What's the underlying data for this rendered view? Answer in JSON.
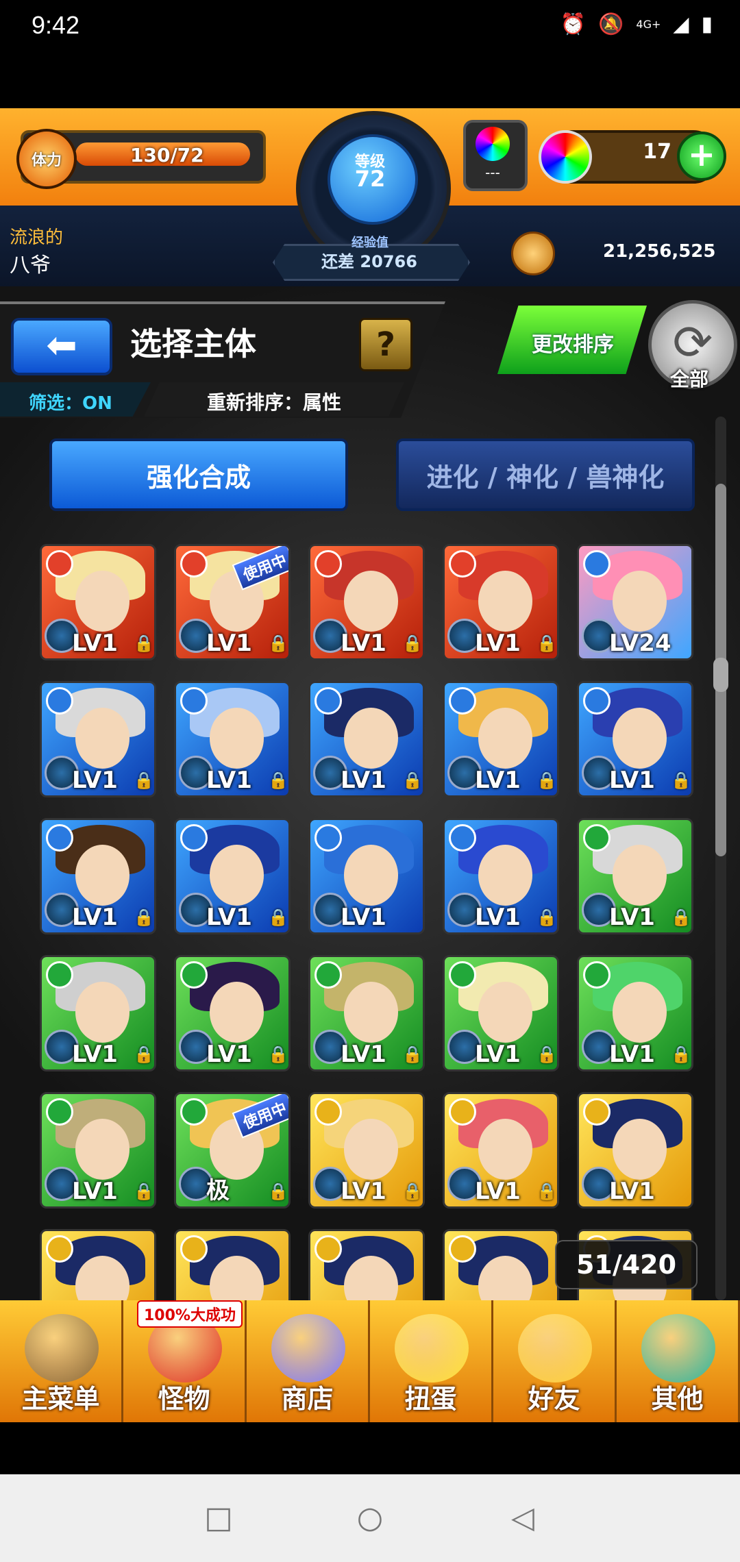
{
  "status_bar": {
    "time": "9:42",
    "network": "4G+"
  },
  "hud": {
    "stamina_label": "体力",
    "stamina_value": "130/72",
    "level_label": "等级",
    "level_value": "72",
    "exp_label": "经验值",
    "exp_remaining": "还差 20766",
    "orb_slot_text": "---",
    "gem_count": "17",
    "user_title": "流浪的",
    "user_name": "八爷",
    "coins": "21,256,525"
  },
  "header": {
    "title": "选择主体",
    "help": "?",
    "filter": "筛选：ON",
    "resort": "重新排序：属性",
    "sort_button": "更改排序",
    "refresh_label": "全部"
  },
  "tabs": [
    "强化合成",
    "进化 / 神化 / 兽神化"
  ],
  "monsters": [
    {
      "element": "fire",
      "level": "LV1",
      "hair": "#f5e3a0"
    },
    {
      "element": "fire",
      "level": "LV1",
      "hair": "#f5e3a0",
      "tag": "使用中"
    },
    {
      "element": "fire",
      "level": "LV1",
      "hair": "#c7352a"
    },
    {
      "element": "fire",
      "level": "LV1",
      "hair": "#d83a2a"
    },
    {
      "element": "pink",
      "level": "LV24",
      "hair": "#ff8fb5"
    },
    {
      "element": "water",
      "level": "LV1",
      "hair": "#d9d9d9"
    },
    {
      "element": "water",
      "level": "LV1",
      "hair": "#a9c8f5"
    },
    {
      "element": "water",
      "level": "LV1",
      "hair": "#1b2a66"
    },
    {
      "element": "water",
      "level": "LV1",
      "hair": "#f0b84a"
    },
    {
      "element": "water",
      "level": "LV1",
      "hair": "#2a3fb0"
    },
    {
      "element": "water",
      "level": "LV1",
      "hair": "#4a2e18"
    },
    {
      "element": "water",
      "level": "LV1",
      "hair": "#1b3aa0"
    },
    {
      "element": "water",
      "level": "LV1",
      "hair": "#2a6fd8"
    },
    {
      "element": "water",
      "level": "LV1",
      "hair": "#2a4ad0"
    },
    {
      "element": "wood",
      "level": "LV1",
      "hair": "#d8d8d8"
    },
    {
      "element": "wood",
      "level": "LV1",
      "hair": "#cfcfcf"
    },
    {
      "element": "wood",
      "level": "LV1",
      "hair": "#2a1a4a"
    },
    {
      "element": "wood",
      "level": "LV1",
      "hair": "#c4b46a"
    },
    {
      "element": "wood",
      "level": "LV1",
      "hair": "#f2eab0"
    },
    {
      "element": "wood",
      "level": "LV1",
      "hair": "#4fd46a"
    },
    {
      "element": "wood",
      "level": "LV1",
      "hair": "#bfae7a"
    },
    {
      "element": "wood",
      "level": "极",
      "hair": "#f0c454",
      "tag": "使用中"
    },
    {
      "element": "light",
      "level": "LV1",
      "hair": "#f5d47a"
    },
    {
      "element": "light",
      "level": "LV1",
      "hair": "#e8606a"
    },
    {
      "element": "light",
      "level": "LV1",
      "hair": "#1b2a66"
    },
    {
      "element": "light",
      "level": "",
      "hair": "#1b2a66"
    },
    {
      "element": "light",
      "level": "",
      "hair": "#1b2a66"
    },
    {
      "element": "light",
      "level": "",
      "hair": "#1b2a66"
    },
    {
      "element": "light",
      "level": "",
      "hair": "#1b2a66"
    },
    {
      "element": "light",
      "level": "",
      "hair": "#1b2a66"
    }
  ],
  "box_count": "51/420",
  "bottom_nav": {
    "badge": "100%大成功",
    "items": [
      {
        "label": "主菜单",
        "color": "#8a6a3a"
      },
      {
        "label": "怪物",
        "color": "#e0342a"
      },
      {
        "label": "商店",
        "color": "#7a7aff"
      },
      {
        "label": "扭蛋",
        "color": "#ffe23a"
      },
      {
        "label": "好友",
        "color": "#ffd43a"
      },
      {
        "label": "其他",
        "color": "#2ab8a0"
      }
    ]
  },
  "colors": {
    "accent": "#f08a12",
    "blue_tab": "#0c5ad6"
  }
}
